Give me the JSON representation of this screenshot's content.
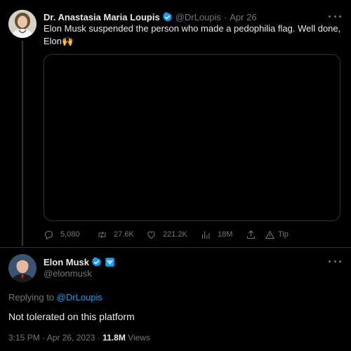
{
  "tweet1": {
    "author_name": "Dr. Anastasia Maria Loupis",
    "handle": "@DrLoupis",
    "separator": "·",
    "date": "Apr 26",
    "text": "Elon Musk suspended the person who made a pedophilia flag. Well done, Elon🙌",
    "verified_badge_color": "#1d9bf0",
    "stats": {
      "replies": "5,080",
      "retweets": "27.6K",
      "likes": "221.2K",
      "views": "18M",
      "tip_label": "Tip"
    },
    "icons": [
      "reply-icon",
      "retweet-icon",
      "like-icon",
      "views-icon",
      "share-icon",
      "tip-icon"
    ]
  },
  "tweet2": {
    "author_name": "Elon Musk",
    "handle": "@elonmusk",
    "replying_prefix": "Replying to",
    "replying_to": "@DrLoupis",
    "text": "Not tolerated on this platform",
    "time": "3:15 PM",
    "meta_sep": "·",
    "date": "Apr 26, 2023",
    "meta_sep2": "·",
    "views_count": "11.8M",
    "views_label": "Views",
    "verified_badge_color": "#1d9bf0",
    "square_badge_color": "#1d9bf0"
  }
}
